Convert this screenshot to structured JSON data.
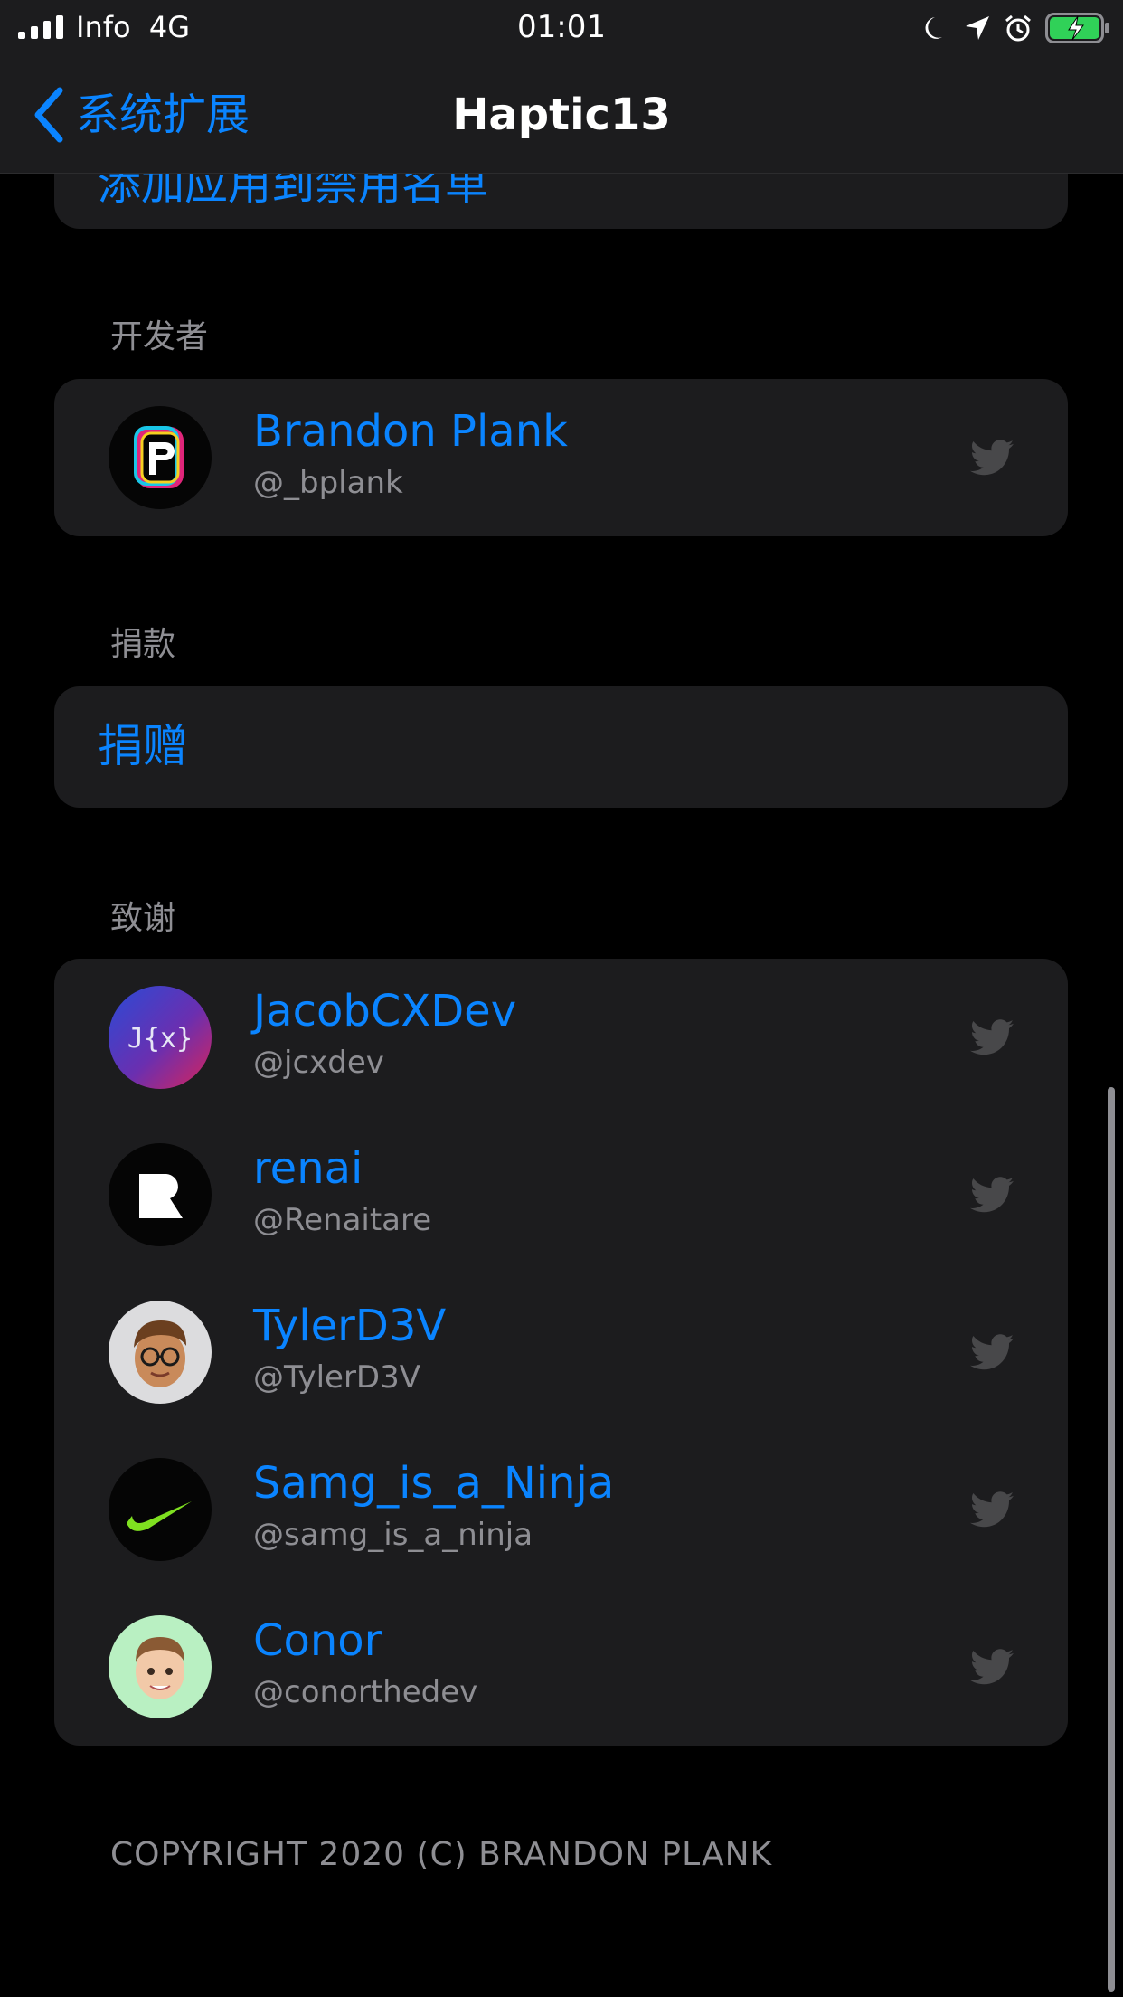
{
  "status_bar": {
    "carrier": "Info",
    "network": "4G",
    "time": "01:01"
  },
  "nav": {
    "back_label": "系统扩展",
    "title": "Haptic13"
  },
  "partial_group": {
    "label": "添加应用到禁用名单"
  },
  "developer_section": {
    "header": "开发者",
    "person": {
      "name": "Brandon Plank",
      "handle": "@_bplank",
      "icon": "twitter-icon"
    }
  },
  "donate_section": {
    "header": "捐款",
    "label": "捐赠"
  },
  "credits_section": {
    "header": "致谢",
    "people": [
      {
        "name": "JacobCXDev",
        "handle": "@jcxdev",
        "icon": "twitter-icon"
      },
      {
        "name": "renai",
        "handle": "@Renaitare",
        "icon": "twitter-icon"
      },
      {
        "name": "TylerD3V",
        "handle": "@TylerD3V",
        "icon": "twitter-icon"
      },
      {
        "name": "Samg_is_a_Ninja",
        "handle": "@samg_is_a_ninja",
        "icon": "twitter-icon"
      },
      {
        "name": "Conor",
        "handle": "@conorthedev",
        "icon": "twitter-icon"
      }
    ]
  },
  "footer": "COPYRIGHT 2020 (C) BRANDON PLANK",
  "colors": {
    "accent": "#0a84ff",
    "background": "#000000",
    "cell": "#1c1c1e",
    "secondary_text": "#8e8e93",
    "battery": "#30d158"
  }
}
